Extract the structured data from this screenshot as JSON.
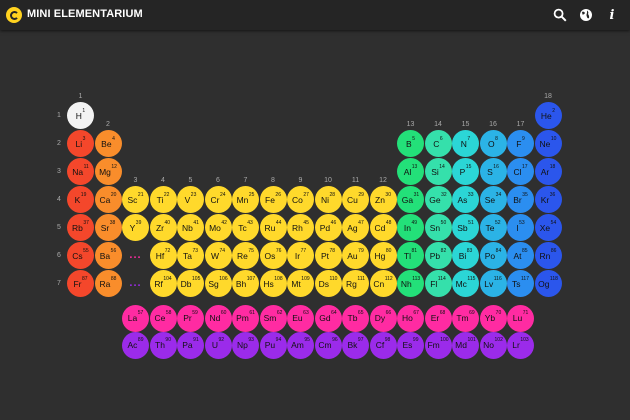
{
  "header": {
    "title": "MINI ELEMENTARIUM",
    "icons": [
      "search-icon",
      "globe-icon",
      "info-icon"
    ],
    "info_glyph": "i"
  },
  "group_labels": [
    "1",
    "2",
    "3",
    "4",
    "5",
    "6",
    "7",
    "8",
    "9",
    "10",
    "11",
    "12",
    "13",
    "14",
    "15",
    "16",
    "17",
    "18"
  ],
  "period_labels": [
    "1",
    "2",
    "3",
    "4",
    "5",
    "6",
    "7"
  ],
  "placeholder": "...",
  "colors": {
    "background": "#2f2f2f",
    "topbar": "#252525",
    "logo": "#ffd21f",
    "group1": "#f4472b",
    "group2": "#f98d2b",
    "transition": "#ffd92b",
    "g13": "#23e079",
    "g14": "#35e0ab",
    "g15": "#2bd6d6",
    "g16": "#2bb3e6",
    "g17": "#2b8ef0",
    "g18": "#2b56ec",
    "lanthanide": "#ff2ba2",
    "actinide": "#9b2bea",
    "hydrogen": "#f3f3f3"
  },
  "elements": [
    {
      "symbol": "H",
      "number": "1",
      "period": 1,
      "group": 1
    },
    {
      "symbol": "He",
      "number": "2",
      "period": 1,
      "group": 18
    },
    {
      "symbol": "Li",
      "number": "3",
      "period": 2,
      "group": 1
    },
    {
      "symbol": "Be",
      "number": "4",
      "period": 2,
      "group": 2
    },
    {
      "symbol": "B",
      "number": "5",
      "period": 2,
      "group": 13
    },
    {
      "symbol": "C",
      "number": "6",
      "period": 2,
      "group": 14
    },
    {
      "symbol": "N",
      "number": "7",
      "period": 2,
      "group": 15
    },
    {
      "symbol": "O",
      "number": "8",
      "period": 2,
      "group": 16
    },
    {
      "symbol": "F",
      "number": "9",
      "period": 2,
      "group": 17
    },
    {
      "symbol": "Ne",
      "number": "10",
      "period": 2,
      "group": 18
    },
    {
      "symbol": "Na",
      "number": "11",
      "period": 3,
      "group": 1
    },
    {
      "symbol": "Mg",
      "number": "12",
      "period": 3,
      "group": 2
    },
    {
      "symbol": "Al",
      "number": "13",
      "period": 3,
      "group": 13
    },
    {
      "symbol": "Si",
      "number": "14",
      "period": 3,
      "group": 14
    },
    {
      "symbol": "P",
      "number": "15",
      "period": 3,
      "group": 15
    },
    {
      "symbol": "S",
      "number": "16",
      "period": 3,
      "group": 16
    },
    {
      "symbol": "Cl",
      "number": "17",
      "period": 3,
      "group": 17
    },
    {
      "symbol": "Ar",
      "number": "18",
      "period": 3,
      "group": 18
    },
    {
      "symbol": "K",
      "number": "19",
      "period": 4,
      "group": 1
    },
    {
      "symbol": "Ca",
      "number": "20",
      "period": 4,
      "group": 2
    },
    {
      "symbol": "Sc",
      "number": "21",
      "period": 4,
      "group": 3
    },
    {
      "symbol": "Ti",
      "number": "22",
      "period": 4,
      "group": 4
    },
    {
      "symbol": "V",
      "number": "23",
      "period": 4,
      "group": 5
    },
    {
      "symbol": "Cr",
      "number": "24",
      "period": 4,
      "group": 6
    },
    {
      "symbol": "Mn",
      "number": "25",
      "period": 4,
      "group": 7
    },
    {
      "symbol": "Fe",
      "number": "26",
      "period": 4,
      "group": 8
    },
    {
      "symbol": "Co",
      "number": "27",
      "period": 4,
      "group": 9
    },
    {
      "symbol": "Ni",
      "number": "28",
      "period": 4,
      "group": 10
    },
    {
      "symbol": "Cu",
      "number": "29",
      "period": 4,
      "group": 11
    },
    {
      "symbol": "Zn",
      "number": "30",
      "period": 4,
      "group": 12
    },
    {
      "symbol": "Ga",
      "number": "31",
      "period": 4,
      "group": 13
    },
    {
      "symbol": "Ge",
      "number": "32",
      "period": 4,
      "group": 14
    },
    {
      "symbol": "As",
      "number": "33",
      "period": 4,
      "group": 15
    },
    {
      "symbol": "Se",
      "number": "34",
      "period": 4,
      "group": 16
    },
    {
      "symbol": "Br",
      "number": "35",
      "period": 4,
      "group": 17
    },
    {
      "symbol": "Kr",
      "number": "36",
      "period": 4,
      "group": 18
    },
    {
      "symbol": "Rb",
      "number": "37",
      "period": 5,
      "group": 1
    },
    {
      "symbol": "Sr",
      "number": "38",
      "period": 5,
      "group": 2
    },
    {
      "symbol": "Y",
      "number": "39",
      "period": 5,
      "group": 3
    },
    {
      "symbol": "Zr",
      "number": "40",
      "period": 5,
      "group": 4
    },
    {
      "symbol": "Nb",
      "number": "41",
      "period": 5,
      "group": 5
    },
    {
      "symbol": "Mo",
      "number": "42",
      "period": 5,
      "group": 6
    },
    {
      "symbol": "Tc",
      "number": "43",
      "period": 5,
      "group": 7
    },
    {
      "symbol": "Ru",
      "number": "44",
      "period": 5,
      "group": 8
    },
    {
      "symbol": "Rh",
      "number": "45",
      "period": 5,
      "group": 9
    },
    {
      "symbol": "Pd",
      "number": "46",
      "period": 5,
      "group": 10
    },
    {
      "symbol": "Ag",
      "number": "47",
      "period": 5,
      "group": 11
    },
    {
      "symbol": "Cd",
      "number": "48",
      "period": 5,
      "group": 12
    },
    {
      "symbol": "In",
      "number": "49",
      "period": 5,
      "group": 13
    },
    {
      "symbol": "Sn",
      "number": "50",
      "period": 5,
      "group": 14
    },
    {
      "symbol": "Sb",
      "number": "51",
      "period": 5,
      "group": 15
    },
    {
      "symbol": "Te",
      "number": "52",
      "period": 5,
      "group": 16
    },
    {
      "symbol": "I",
      "number": "53",
      "period": 5,
      "group": 17
    },
    {
      "symbol": "Xe",
      "number": "54",
      "period": 5,
      "group": 18
    },
    {
      "symbol": "Cs",
      "number": "55",
      "period": 6,
      "group": 1
    },
    {
      "symbol": "Ba",
      "number": "56",
      "period": 6,
      "group": 2
    },
    {
      "symbol": "Hf",
      "number": "72",
      "period": 6,
      "group": 4
    },
    {
      "symbol": "Ta",
      "number": "73",
      "period": 6,
      "group": 5
    },
    {
      "symbol": "W",
      "number": "74",
      "period": 6,
      "group": 6
    },
    {
      "symbol": "Re",
      "number": "75",
      "period": 6,
      "group": 7
    },
    {
      "symbol": "Os",
      "number": "76",
      "period": 6,
      "group": 8
    },
    {
      "symbol": "Ir",
      "number": "77",
      "period": 6,
      "group": 9
    },
    {
      "symbol": "Pt",
      "number": "78",
      "period": 6,
      "group": 10
    },
    {
      "symbol": "Au",
      "number": "79",
      "period": 6,
      "group": 11
    },
    {
      "symbol": "Hg",
      "number": "80",
      "period": 6,
      "group": 12
    },
    {
      "symbol": "Tl",
      "number": "81",
      "period": 6,
      "group": 13
    },
    {
      "symbol": "Pb",
      "number": "82",
      "period": 6,
      "group": 14
    },
    {
      "symbol": "Bi",
      "number": "83",
      "period": 6,
      "group": 15
    },
    {
      "symbol": "Po",
      "number": "84",
      "period": 6,
      "group": 16
    },
    {
      "symbol": "At",
      "number": "85",
      "period": 6,
      "group": 17
    },
    {
      "symbol": "Rn",
      "number": "86",
      "period": 6,
      "group": 18
    },
    {
      "symbol": "Fr",
      "number": "87",
      "period": 7,
      "group": 1
    },
    {
      "symbol": "Ra",
      "number": "88",
      "period": 7,
      "group": 2
    },
    {
      "symbol": "Rf",
      "number": "104",
      "period": 7,
      "group": 4
    },
    {
      "symbol": "Db",
      "number": "105",
      "period": 7,
      "group": 5
    },
    {
      "symbol": "Sg",
      "number": "106",
      "period": 7,
      "group": 6
    },
    {
      "symbol": "Bh",
      "number": "107",
      "period": 7,
      "group": 7
    },
    {
      "symbol": "Hs",
      "number": "108",
      "period": 7,
      "group": 8
    },
    {
      "symbol": "Mt",
      "number": "109",
      "period": 7,
      "group": 9
    },
    {
      "symbol": "Ds",
      "number": "110",
      "period": 7,
      "group": 10
    },
    {
      "symbol": "Rg",
      "number": "111",
      "period": 7,
      "group": 11
    },
    {
      "symbol": "Cn",
      "number": "112",
      "period": 7,
      "group": 12
    },
    {
      "symbol": "Nh",
      "number": "113",
      "period": 7,
      "group": 13
    },
    {
      "symbol": "Fl",
      "number": "114",
      "period": 7,
      "group": 14
    },
    {
      "symbol": "Mc",
      "number": "115",
      "period": 7,
      "group": 15
    },
    {
      "symbol": "Lv",
      "number": "116",
      "period": 7,
      "group": 16
    },
    {
      "symbol": "Ts",
      "number": "117",
      "period": 7,
      "group": 17
    },
    {
      "symbol": "Og",
      "number": "118",
      "period": 7,
      "group": 18
    }
  ],
  "lanthanides": [
    {
      "symbol": "La",
      "number": "57"
    },
    {
      "symbol": "Ce",
      "number": "58"
    },
    {
      "symbol": "Pr",
      "number": "59"
    },
    {
      "symbol": "Nd",
      "number": "60"
    },
    {
      "symbol": "Pm",
      "number": "61"
    },
    {
      "symbol": "Sm",
      "number": "62"
    },
    {
      "symbol": "Eu",
      "number": "63"
    },
    {
      "symbol": "Gd",
      "number": "64"
    },
    {
      "symbol": "Tb",
      "number": "65"
    },
    {
      "symbol": "Dy",
      "number": "66"
    },
    {
      "symbol": "Ho",
      "number": "67"
    },
    {
      "symbol": "Er",
      "number": "68"
    },
    {
      "symbol": "Tm",
      "number": "69"
    },
    {
      "symbol": "Yb",
      "number": "70"
    },
    {
      "symbol": "Lu",
      "number": "71"
    }
  ],
  "actinides": [
    {
      "symbol": "Ac",
      "number": "89"
    },
    {
      "symbol": "Th",
      "number": "90"
    },
    {
      "symbol": "Pa",
      "number": "91"
    },
    {
      "symbol": "U",
      "number": "92"
    },
    {
      "symbol": "Np",
      "number": "93"
    },
    {
      "symbol": "Pu",
      "number": "94"
    },
    {
      "symbol": "Am",
      "number": "95"
    },
    {
      "symbol": "Cm",
      "number": "96"
    },
    {
      "symbol": "Bk",
      "number": "97"
    },
    {
      "symbol": "Cf",
      "number": "98"
    },
    {
      "symbol": "Es",
      "number": "99"
    },
    {
      "symbol": "Fm",
      "number": "100"
    },
    {
      "symbol": "Md",
      "number": "101"
    },
    {
      "symbol": "No",
      "number": "102"
    },
    {
      "symbol": "Lr",
      "number": "103"
    }
  ]
}
